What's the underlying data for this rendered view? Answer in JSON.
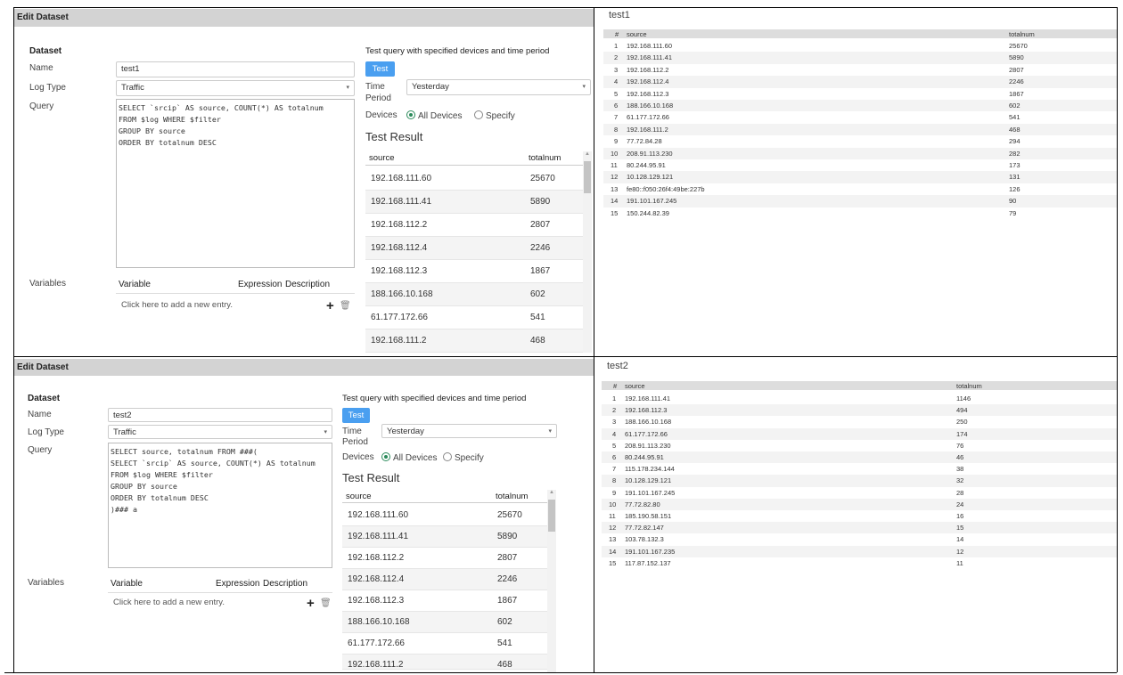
{
  "panels": [
    {
      "header": "Edit Dataset",
      "dataset_title": "Dataset",
      "name_label": "Name",
      "name_value": "test1",
      "log_type_label": "Log Type",
      "log_type_value": "Traffic",
      "query_label": "Query",
      "query_value": "SELECT `srcip` AS source, COUNT(*) AS totalnum\nFROM $log WHERE $filter\nGROUP BY source\nORDER BY totalnum DESC",
      "variables_label": "Variables",
      "variables_columns": [
        "Variable",
        "Expression",
        "Description"
      ],
      "add_entry_text": "Click here to add a new entry.",
      "test_title": "Test query with specified devices and time period",
      "test_button": "Test",
      "time_label": "Time",
      "period_label": "Period",
      "time_value": "Yesterday",
      "devices_label": "Devices",
      "all_devices": "All Devices",
      "specify": "Specify",
      "result_title": "Test Result",
      "result_columns": [
        "source",
        "totalnum"
      ],
      "result_rows": [
        [
          "192.168.111.60",
          "25670"
        ],
        [
          "192.168.111.41",
          "5890"
        ],
        [
          "192.168.112.2",
          "2807"
        ],
        [
          "192.168.112.4",
          "2246"
        ],
        [
          "192.168.112.3",
          "1867"
        ],
        [
          "188.166.10.168",
          "602"
        ],
        [
          "61.177.172.66",
          "541"
        ],
        [
          "192.168.111.2",
          "468"
        ]
      ]
    },
    {
      "header": "Edit Dataset",
      "dataset_title": "Dataset",
      "name_label": "Name",
      "name_value": "test2",
      "log_type_label": "Log Type",
      "log_type_value": "Traffic",
      "query_label": "Query",
      "query_value": "SELECT source, totalnum FROM ###(\nSELECT `srcip` AS source, COUNT(*) AS totalnum\nFROM $log WHERE $filter\nGROUP BY source\nORDER BY totalnum DESC\n)### a",
      "variables_label": "Variables",
      "variables_columns": [
        "Variable",
        "Expression",
        "Description"
      ],
      "add_entry_text": "Click here to add a new entry.",
      "test_title": "Test query with specified devices and time period",
      "test_button": "Test",
      "time_label": "Time",
      "period_label": "Period",
      "time_value": "Yesterday",
      "devices_label": "Devices",
      "all_devices": "All Devices",
      "specify": "Specify",
      "result_title": "Test Result",
      "result_columns": [
        "source",
        "totalnum"
      ],
      "result_rows": [
        [
          "192.168.111.60",
          "25670"
        ],
        [
          "192.168.111.41",
          "5890"
        ],
        [
          "192.168.112.2",
          "2807"
        ],
        [
          "192.168.112.4",
          "2246"
        ],
        [
          "192.168.112.3",
          "1867"
        ],
        [
          "188.166.10.168",
          "602"
        ],
        [
          "61.177.172.66",
          "541"
        ],
        [
          "192.168.111.2",
          "468"
        ]
      ]
    }
  ],
  "results": [
    {
      "title": "test1",
      "columns": [
        "#",
        "source",
        "totalnum"
      ],
      "rows": [
        [
          "1",
          "192.168.111.60",
          "25670"
        ],
        [
          "2",
          "192.168.111.41",
          "5890"
        ],
        [
          "3",
          "192.168.112.2",
          "2807"
        ],
        [
          "4",
          "192.168.112.4",
          "2246"
        ],
        [
          "5",
          "192.168.112.3",
          "1867"
        ],
        [
          "6",
          "188.166.10.168",
          "602"
        ],
        [
          "7",
          "61.177.172.66",
          "541"
        ],
        [
          "8",
          "192.168.111.2",
          "468"
        ],
        [
          "9",
          "77.72.84.28",
          "294"
        ],
        [
          "10",
          "208.91.113.230",
          "282"
        ],
        [
          "11",
          "80.244.95.91",
          "173"
        ],
        [
          "12",
          "10.128.129.121",
          "131"
        ],
        [
          "13",
          "fe80::f050:26f4:49be:227b",
          "126"
        ],
        [
          "14",
          "191.101.167.245",
          "90"
        ],
        [
          "15",
          "150.244.82.39",
          "79"
        ]
      ]
    },
    {
      "title": "test2",
      "columns": [
        "#",
        "source",
        "totalnum"
      ],
      "rows": [
        [
          "1",
          "192.168.111.41",
          "1146"
        ],
        [
          "2",
          "192.168.112.3",
          "494"
        ],
        [
          "3",
          "188.166.10.168",
          "250"
        ],
        [
          "4",
          "61.177.172.66",
          "174"
        ],
        [
          "5",
          "208.91.113.230",
          "76"
        ],
        [
          "6",
          "80.244.95.91",
          "46"
        ],
        [
          "7",
          "115.178.234.144",
          "38"
        ],
        [
          "8",
          "10.128.129.121",
          "32"
        ],
        [
          "9",
          "191.101.167.245",
          "28"
        ],
        [
          "10",
          "77.72.82.80",
          "24"
        ],
        [
          "11",
          "185.190.58.151",
          "16"
        ],
        [
          "12",
          "77.72.82.147",
          "15"
        ],
        [
          "13",
          "103.78.132.3",
          "14"
        ],
        [
          "14",
          "191.101.167.235",
          "12"
        ],
        [
          "15",
          "117.87.152.137",
          "11"
        ]
      ]
    }
  ],
  "colors": {
    "accent": "#4a9ff0",
    "header_bg": "#d3d3d3",
    "radio": "#2a8a5a"
  }
}
